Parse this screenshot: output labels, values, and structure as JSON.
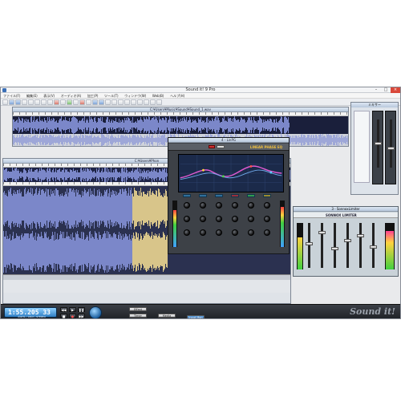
{
  "app": {
    "title": "Sound it! 9 Pro"
  },
  "menu": [
    "ファイル(F)",
    "編集(E)",
    "表示(V)",
    "オーディオ(A)",
    "加工(P)",
    "ツール(T)",
    "ウィンドウ(W)",
    "Web(B)",
    "ヘルプ(H)"
  ],
  "windows": {
    "file1_title": "C:¥Users¥Music¥Sound¥Sound_1.wav",
    "file2_title": "C:¥Users¥Phon",
    "plugin_title": "4 - LinPG",
    "plugin_name": "LINEAR PHASE EQ",
    "limiter_title": "3 - SonnoxLimiter",
    "limiter_name": "SONNOX LIMITER",
    "mixer_title": "ミキサー"
  },
  "transport": {
    "time": "1:55.205 33",
    "info": "44kHz / 16bit / STEREO",
    "effect_label": "Effect",
    "timer_label": "Timer",
    "media_label": "Media",
    "input_mon_label": "Input Mon"
  },
  "brand": "Sound it!",
  "colors": {
    "wave_bg": "#1a1f3b",
    "wave_fg": "#7b87c9",
    "lcd": "#2f7ec4",
    "accent": "#3b6fb6"
  }
}
